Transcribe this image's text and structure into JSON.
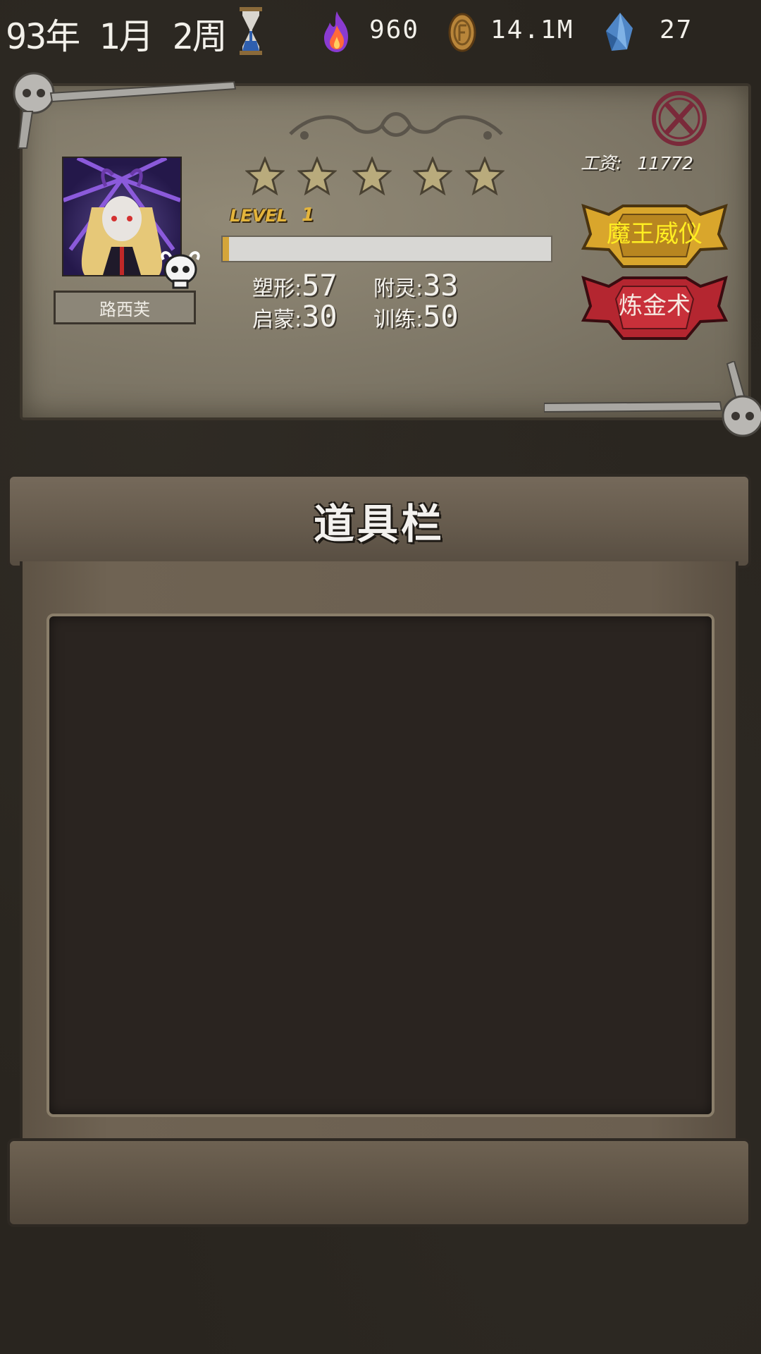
{
  "topbar": {
    "date": "93年 1月 2周",
    "resources": [
      {
        "name": "flame",
        "icon": "flame-icon",
        "value": "960"
      },
      {
        "name": "coin",
        "icon": "coin-icon",
        "value": "14.1M"
      },
      {
        "name": "crystal",
        "icon": "crystal-icon",
        "value": "27"
      }
    ]
  },
  "character": {
    "name": "路西芙",
    "stars": 5,
    "level_label": "LEVEL",
    "level": "1",
    "xp_fraction": 0.02,
    "salary_label": "工资:",
    "salary_value": "11772",
    "stats": [
      {
        "label": "塑形:",
        "value": "57"
      },
      {
        "label": "附灵:",
        "value": "33"
      },
      {
        "label": "启蒙:",
        "value": "30"
      },
      {
        "label": "训练:",
        "value": "50"
      }
    ]
  },
  "buttons": {
    "majesty": "魔王威仪",
    "alchemy": "炼金术"
  },
  "inventory": {
    "title": "道具栏"
  },
  "colors": {
    "majesty_text": "#ffee22",
    "alchemy_text": "#f6e8e0",
    "gold": "#d4a53a",
    "crimson": "#b42630"
  }
}
